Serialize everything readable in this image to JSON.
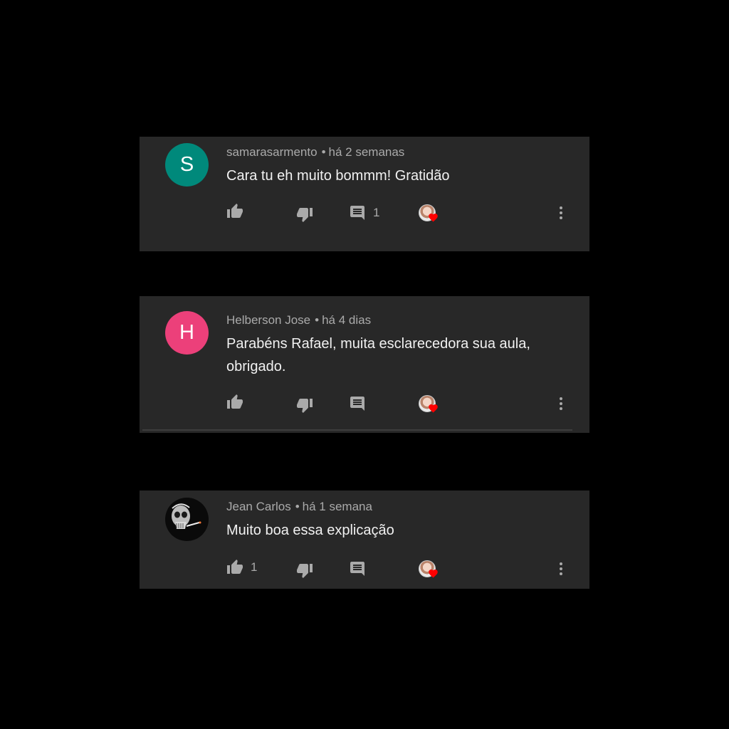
{
  "colors": {
    "page_bg": "#000000",
    "card_bg": "#282828",
    "heart": "#ff0000"
  },
  "comments": [
    {
      "author": "samarasarmento",
      "time": "há 2 semanas",
      "text": "Cara tu eh muito bommm! Gratidão",
      "avatar_letter": "S",
      "avatar_color": "#00897b",
      "likes": "",
      "replies": "1"
    },
    {
      "author": "Helberson Jose",
      "time": "há 4 dias",
      "text": "Parabéns Rafael, muita esclarecedora sua aula, obrigado.",
      "avatar_letter": "H",
      "avatar_color": "#ec407a",
      "likes": "",
      "replies": ""
    },
    {
      "author": "Jean Carlos",
      "time": "há 1 semana",
      "text": "Muito boa essa explicação",
      "avatar_letter": "",
      "avatar_color": "#111111",
      "likes": "1",
      "replies": ""
    }
  ],
  "icons": {
    "like": "thumb-up-icon",
    "dislike": "thumb-down-icon",
    "reply": "comment-icon",
    "hearted": "creator-heart-icon",
    "more": "more-vertical-icon"
  },
  "separator": "•"
}
